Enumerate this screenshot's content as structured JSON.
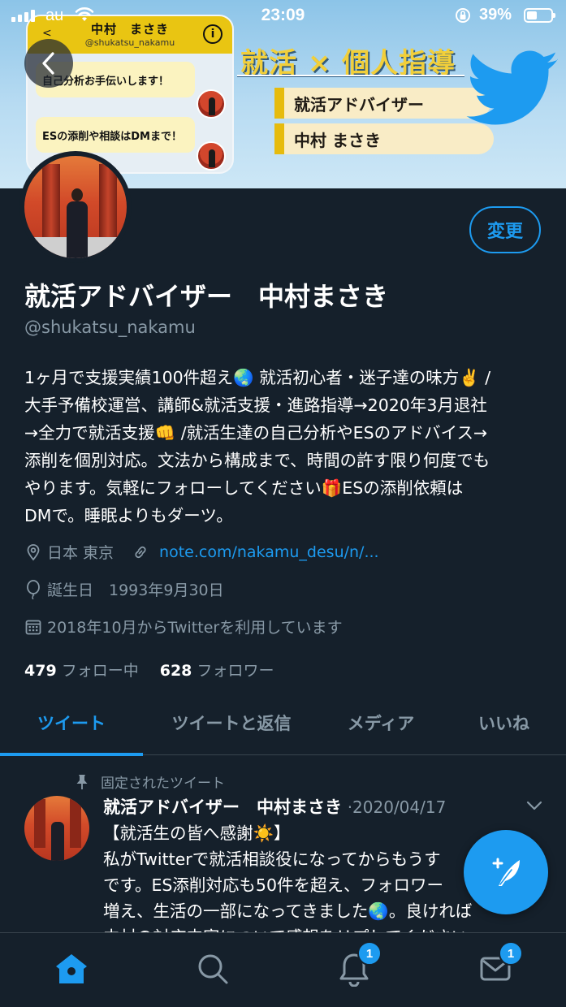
{
  "status_bar": {
    "carrier": "au",
    "time": "23:09",
    "battery": "39%"
  },
  "banner": {
    "chat_card": {
      "name": "中村　まさき",
      "handle": "@shukatsu_nakamu",
      "back": "<",
      "info": "i",
      "messages": [
        "自己分析お手伝いします！",
        "ESの添削や相談はDMまで！"
      ]
    },
    "title": "就活 × 個人指導",
    "tags": [
      "就活アドバイザー",
      "中村 まさき"
    ]
  },
  "profile": {
    "edit_label": "変更",
    "display_name": "就活アドバイザー　中村まさき",
    "handle": "@shukatsu_nakamu",
    "bio_lines": [
      "1ヶ月で支援実績100件超え🌏 就活初心者・迷子達の味方✌️ /",
      "大手予備校運営、講師&就活支援・進路指導→2020年3月退社",
      "→全力で就活支援👊 /就活生達の自己分析やESのアドバイス→",
      "添削を個別対応。文法から構成まで、時間の許す限り何度でも",
      "やります。気軽にフォローしてください🎁ESの添削依頼は",
      "DMで。睡眠よりもダーツ。"
    ],
    "location": "日本 東京",
    "url": "note.com/nakamu_desu/n/...",
    "birthday": "誕生日　1993年9月30日",
    "joined": "2018年10月からTwitterを利用しています",
    "following_count": "479",
    "following_label": "フォロー中",
    "followers_count": "628",
    "followers_label": "フォロワー"
  },
  "tabs": [
    "ツイート",
    "ツイートと返信",
    "メディア",
    "いいね"
  ],
  "active_tab": "ツイート",
  "pinned_tweet": {
    "pinned_label": "固定されたツイート",
    "name": "就活アドバイザー　中村まさき",
    "date": "·2020/04/17",
    "lines": [
      "【就活生の皆へ感謝☀️】",
      "私がTwitterで就活相談役になってからもうす",
      "です。ES添削対応も50件を超え、フォロワー",
      "増え、生活の一部になってきました🌏。良ければ",
      "中村の対応内容について感想をリプしてください"
    ]
  },
  "bottom_nav": {
    "items": [
      "home-icon",
      "search-icon",
      "notifications-icon",
      "messages-icon"
    ],
    "notifications_badge": "1",
    "messages_badge": "1"
  },
  "colors": {
    "background": "#15202b",
    "accent": "#1d9bf0",
    "secondary_text": "#8899a6",
    "banner_yellow": "#e6bb0d"
  }
}
